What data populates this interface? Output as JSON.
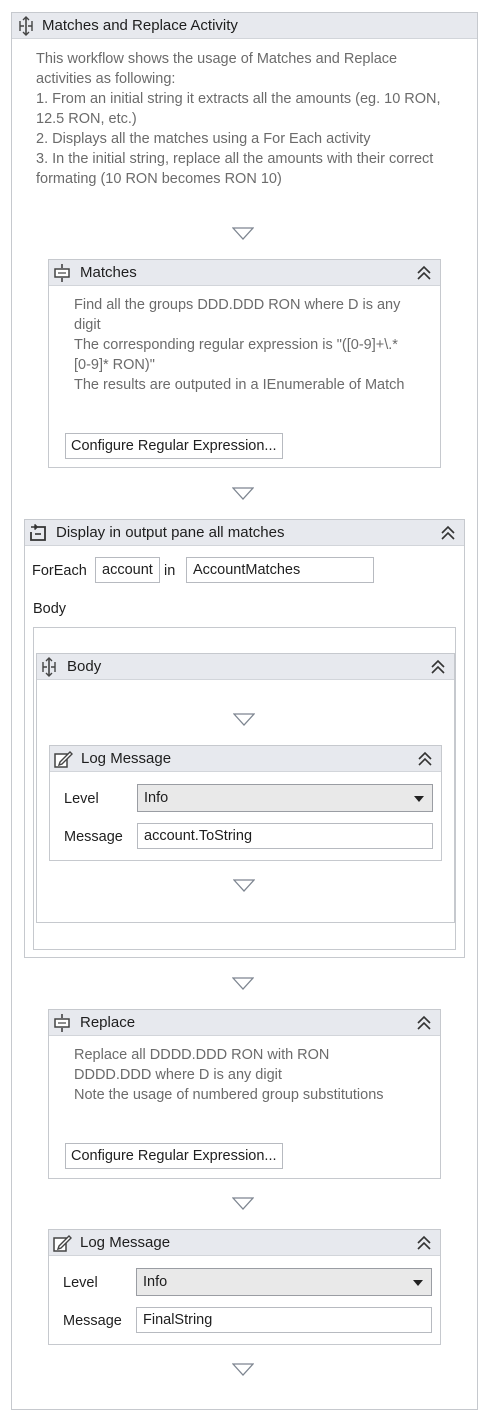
{
  "root": {
    "title": "Matches and Replace Activity",
    "icon": "sequence-icon",
    "description": [
      "This workflow shows the usage of Matches and Replace",
      "activities as following:",
      "1. From an initial string it extracts all the amounts (eg. 10 RON,",
      "12.5 RON, etc.)",
      "2. Displays all the matches using a For Each activity",
      "3. In the initial string, replace all the amounts with their correct",
      "formating (10 RON becomes RON 10)"
    ]
  },
  "matches": {
    "title": "Matches",
    "icon": "activity-icon",
    "description": [
      "Find all the groups DDD.DDD RON where D is any",
      "digit",
      "The corresponding regular expression is \"([0-9]+\\.*",
      "[0-9]* RON)\"",
      "The results are outputed in a IEnumerable of Match"
    ],
    "button_label": "Configure Regular Expression..."
  },
  "foreach": {
    "title": "Display in output pane all matches",
    "icon": "foreach-icon",
    "foreach_label": "ForEach",
    "item_var": "account",
    "in_label": "in",
    "collection": "AccountMatches",
    "body_label": "Body",
    "body": {
      "title": "Body",
      "icon": "sequence-icon",
      "log": {
        "title": "Log Message",
        "icon": "log-message-icon",
        "level_label": "Level",
        "level_value": "Info",
        "message_label": "Message",
        "message_value": "account.ToString"
      }
    }
  },
  "replace": {
    "title": "Replace",
    "icon": "activity-icon",
    "description": [
      "Replace all DDDD.DDD RON with RON",
      "DDDD.DDD where D is any digit",
      "Note the usage of numbered group substitutions"
    ],
    "button_label": "Configure Regular Expression..."
  },
  "final_log": {
    "title": "Log Message",
    "icon": "log-message-icon",
    "level_label": "Level",
    "level_value": "Info",
    "message_label": "Message",
    "message_value": "FinalString"
  },
  "colors": {
    "header_bg": "#e7e9ee",
    "border": "#c6c9ce",
    "description_text": "#6b6b6b",
    "select_bg": "#e9e9e9"
  }
}
